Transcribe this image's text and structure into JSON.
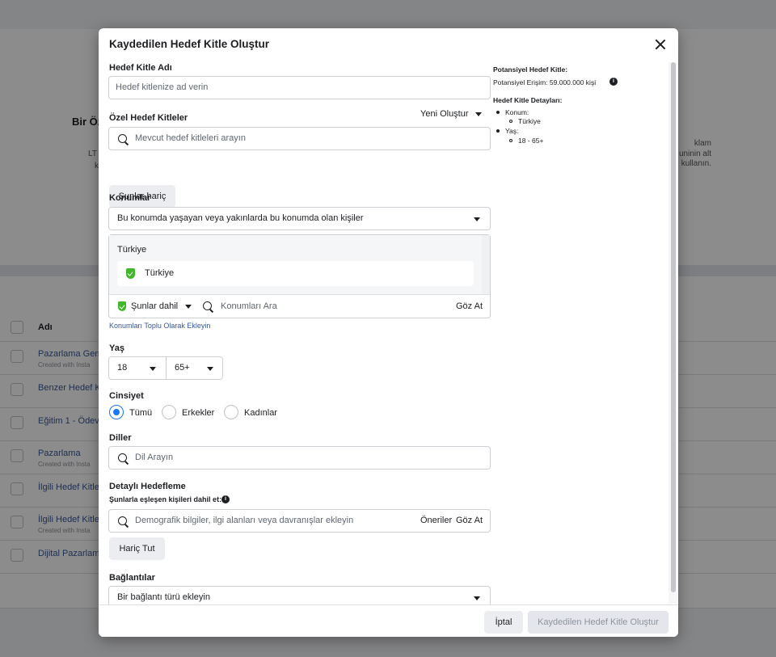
{
  "background": {
    "title": "Bir Öz",
    "left_text": [
      "LT",
      "k"
    ],
    "right_text": [
      "klam",
      "uninin alt",
      "kullanın."
    ],
    "table_header": "Adı",
    "rows": [
      {
        "name": "Pazarlama Gen",
        "sub": "Created with Insta"
      },
      {
        "name": "Benzer Hedef K",
        "sub": ""
      },
      {
        "name": "Eğitim 1 - Ödev",
        "sub": ""
      },
      {
        "name": "Pazarlama",
        "sub": "Created with Insta"
      },
      {
        "name": "İlgili Hedef Kitle",
        "sub": ""
      },
      {
        "name": "İlgili Hedef Kitle",
        "sub": "Created with Insta"
      },
      {
        "name": "Dijital Pazarlam",
        "sub": ""
      }
    ]
  },
  "modal": {
    "title": "Kaydedilen Hedef Kitle Oluştur",
    "audience_name": {
      "label": "Hedef Kitle Adı",
      "placeholder": "Hedef kitlenize ad verin"
    },
    "custom_audiences": {
      "label": "Özel Hedef Kitleler",
      "create_new": "Yeni Oluştur",
      "search_placeholder": "Mevcut hedef kitleleri arayın",
      "exclude_button": "Şunlar hariç"
    },
    "locations": {
      "label": "Konumlar",
      "mode": "Bu konumda yaşayan veya yakınlarda bu konumda olan kişiler",
      "group_title": "Türkiye",
      "selected": "Türkiye",
      "include_mode": "Şunlar dahil",
      "search_placeholder": "Konumları Ara",
      "browse": "Göz At",
      "bulk_link": "Konumları Toplu Olarak Ekleyin"
    },
    "age": {
      "label": "Yaş",
      "min": "18",
      "max": "65+"
    },
    "gender": {
      "label": "Cinsiyet",
      "options": [
        "Tümü",
        "Erkekler",
        "Kadınlar"
      ],
      "selected": "Tümü"
    },
    "languages": {
      "label": "Diller",
      "placeholder": "Dil Arayın"
    },
    "detailed": {
      "label": "Detaylı Hedefleme",
      "sublabel": "Şunlarla eşleşen kişileri dahil et:",
      "placeholder": "Demografik bilgiler, ilgi alanları veya davranışlar ekleyin",
      "suggestions": "Öneriler",
      "browse": "Göz At",
      "exclude_button": "Hariç Tut"
    },
    "connections": {
      "label": "Bağlantılar",
      "placeholder": "Bir bağlantı türü ekleyin"
    },
    "summary": {
      "potential_title": "Potansiyel Hedef Kitle:",
      "reach": "Potansiyel Erişim: 59.000.000 kişi",
      "details_title": "Hedef Kitle Detayları:",
      "location_label": "Konum:",
      "location_value": "Türkiye",
      "age_label": "Yaş:",
      "age_value": "18 - 65+"
    },
    "footer": {
      "cancel": "İptal",
      "create": "Kaydedilen Hedef Kitle Oluştur"
    }
  },
  "colors": {
    "accent": "#1877f2",
    "link": "#385898",
    "location_green": "#42b72a"
  }
}
